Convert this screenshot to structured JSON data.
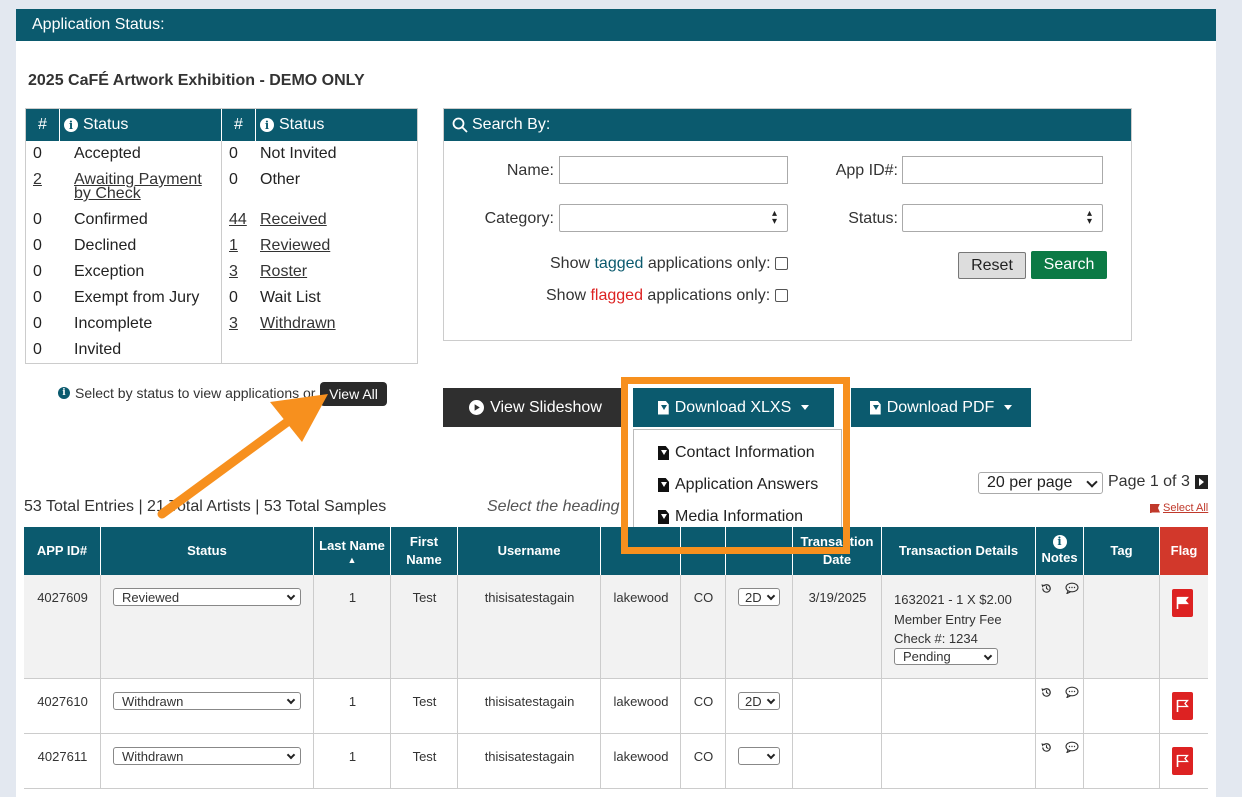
{
  "header": {
    "title": "Application Status:"
  },
  "exhibition_title": "2025 CaFÉ Artwork Exhibition - DEMO ONLY",
  "status_table": {
    "col_num": "#",
    "col_status": "Status",
    "left": [
      {
        "count": "0",
        "label": "Accepted",
        "link": false
      },
      {
        "count": "2",
        "label": "Awaiting Payment by Check",
        "link": true
      },
      {
        "count": "0",
        "label": "Confirmed",
        "link": false
      },
      {
        "count": "0",
        "label": "Declined",
        "link": false
      },
      {
        "count": "0",
        "label": "Exception",
        "link": false
      },
      {
        "count": "0",
        "label": "Exempt from Jury",
        "link": false
      },
      {
        "count": "0",
        "label": "Incomplete",
        "link": false
      },
      {
        "count": "0",
        "label": "Invited",
        "link": false
      }
    ],
    "right": [
      {
        "count": "0",
        "label": "Not Invited",
        "link": false
      },
      {
        "count": "0",
        "label": "Other",
        "link": false
      },
      {
        "count": "44",
        "label": "Received",
        "link": true
      },
      {
        "count": "1",
        "label": "Reviewed",
        "link": true
      },
      {
        "count": "3",
        "label": "Roster",
        "link": true
      },
      {
        "count": "0",
        "label": "Wait List",
        "link": false
      },
      {
        "count": "3",
        "label": "Withdrawn",
        "link": true
      }
    ]
  },
  "select_hint": "Select by status to view applications or",
  "view_all_label": "View All",
  "search": {
    "title": "Search By:",
    "name_label": "Name:",
    "app_id_label": "App ID#:",
    "category_label": "Category:",
    "status_label": "Status:",
    "tagged_pre": "Show ",
    "tagged_word": "tagged",
    "tagged_post": " applications only:",
    "flagged_pre": "Show ",
    "flagged_word": "flagged",
    "flagged_post": " applications only:",
    "reset_label": "Reset",
    "search_label": "Search"
  },
  "actions": {
    "slideshow_label": "View Slideshow",
    "xlxs_label": "Download XLXS",
    "pdf_label": "Download PDF",
    "dropdown_items": [
      "Contact Information",
      "Application Answers",
      "Media Information"
    ]
  },
  "pager": {
    "per_page": "20 per page",
    "page_text": "Page 1 of 3"
  },
  "totals_text": "53 Total Entries | 21 Total Artists | 53 Total Samples",
  "heading_hint": "Select the heading",
  "select_all_label": "Select All",
  "table": {
    "headers": {
      "app_id": "APP ID#",
      "status": "Status",
      "last_name": "Last Name",
      "last_name_sort": "▲",
      "first_name": "First Name",
      "username": "Username",
      "transaction_date": "Transaction Date",
      "transaction_details": "Transaction Details",
      "notes": "Notes",
      "tag": "Tag",
      "flag": "Flag"
    },
    "rows": [
      {
        "app_id": "4027609",
        "status": "Reviewed",
        "last": "1",
        "first": "Test",
        "username": "thisisatestagain",
        "city": "lakewood",
        "state": "CO",
        "category": "2D",
        "date": "3/19/2025",
        "details_line1": "1632021 - 1 X $2.00",
        "details_line2": "Member Entry Fee",
        "details_line3": "Check #: 1234",
        "payment_status": "Pending",
        "flagged": true
      },
      {
        "app_id": "4027610",
        "status": "Withdrawn",
        "last": "1",
        "first": "Test",
        "username": "thisisatestagain",
        "city": "lakewood",
        "state": "CO",
        "category": "2D",
        "date": "",
        "flagged": false
      },
      {
        "app_id": "4027611",
        "status": "Withdrawn",
        "last": "1",
        "first": "Test",
        "username": "thisisatestagain",
        "city": "lakewood",
        "state": "CO",
        "category": "",
        "date": "",
        "flagged": false
      }
    ]
  },
  "colors": {
    "header_teal": "#0b5a6e",
    "search_green": "#0b7a45",
    "flag_red": "#d22222",
    "highlight_orange": "#f7901e"
  }
}
